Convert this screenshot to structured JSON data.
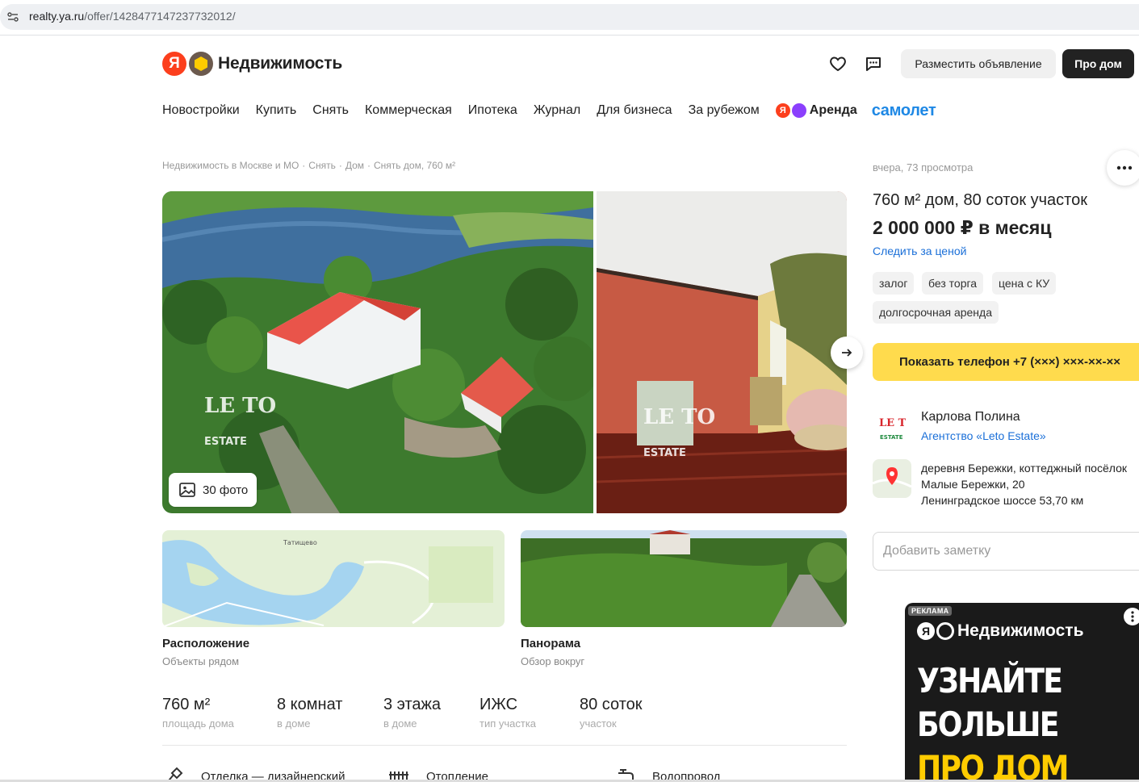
{
  "browser": {
    "url_host": "realty.ya.ru",
    "url_path": "/offer/1428477147237732012/"
  },
  "header": {
    "logo_ya": "Я",
    "logo_text": "Недвижимость",
    "favorites_icon": "heart-icon",
    "messages_icon": "chat-icon",
    "post_button": "Разместить объявление",
    "prodom_button": "Про дом"
  },
  "nav": {
    "items": [
      "Новостройки",
      "Купить",
      "Снять",
      "Коммерческая",
      "Ипотека",
      "Журнал",
      "Для бизнеса",
      "За рубежом"
    ],
    "arenda_ya": "Я",
    "arenda": "Аренда",
    "samolet": "самолет"
  },
  "breadcrumbs": [
    "Недвижимость в Москве и МО",
    "Снять",
    "Дом",
    "Снять дом, 760 м²"
  ],
  "gallery": {
    "watermark_1": "LE TO",
    "watermark_2": "ESTATE",
    "photo_count": "30 фото"
  },
  "location_card": {
    "map_village": "Татищево",
    "title": "Расположение",
    "subtitle": "Объекты рядом"
  },
  "panorama_card": {
    "title": "Панорама",
    "subtitle": "Обзор вокруг"
  },
  "features": [
    {
      "value": "760 м²",
      "label": "площадь дома"
    },
    {
      "value": "8 комнат",
      "label": "в доме"
    },
    {
      "value": "3 этажа",
      "label": "в доме"
    },
    {
      "value": "ИЖС",
      "label": "тип участка"
    },
    {
      "value": "80 соток",
      "label": "участок"
    }
  ],
  "amenities": [
    "Отделка — дизайнерский",
    "Отопление",
    "Водопровод"
  ],
  "offer": {
    "meta": "вчера, 73 просмотра",
    "title": "760 м² дом, 80 соток участок",
    "price": "2 000 000 ₽ в месяц",
    "watch_price": "Следить за ценой",
    "tags": [
      "залог",
      "без торга",
      "цена с КУ",
      "долгосрочная аренда"
    ],
    "phone_button": "Показать телефон +7 (×××) ×××-××-××"
  },
  "agent": {
    "logo_1": "LE TO",
    "logo_2": "ESTATE",
    "name": "Карлова Полина",
    "agency": "Агентство «Leto Estate»"
  },
  "address": {
    "line1": "деревня Бережки, коттеджный посёлок",
    "line2": "Малые Бережки, 20",
    "line3": "Ленинградское шоссе 53,70 км"
  },
  "note_placeholder": "Добавить заметку",
  "ad": {
    "label": "РЕКЛАМА",
    "logo_ya": "Я",
    "logo_text": "Недвижимость",
    "line1": "УЗНАЙТЕ",
    "line2": "БОЛЬШЕ",
    "line3": "ПРО ДОМ"
  },
  "colors": {
    "accent_yellow": "#ffdb4d",
    "link_blue": "#1a6fd8",
    "yandex_red": "#fc3f1d",
    "samolet_blue": "#1e88e5"
  }
}
